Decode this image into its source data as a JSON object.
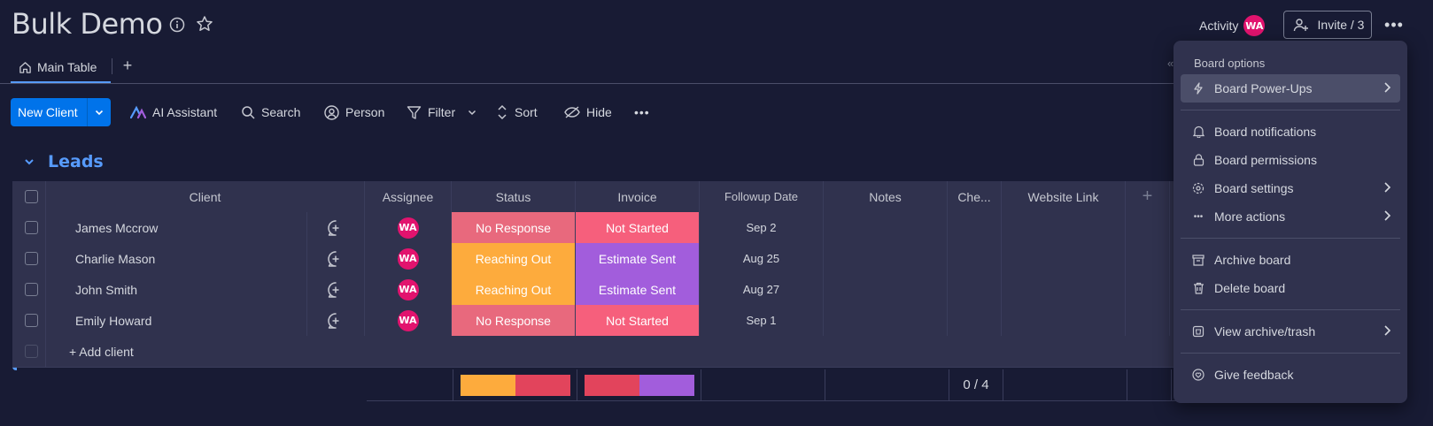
{
  "header": {
    "title": "Bulk Demo",
    "activity_label": "Activity",
    "user_initials": "WA",
    "invite_label": "Invite / 3"
  },
  "tabs": [
    {
      "label": "Main Table"
    }
  ],
  "toolbar": {
    "new_label": "New Client",
    "ai_label": "AI Assistant",
    "search_label": "Search",
    "person_label": "Person",
    "filter_label": "Filter",
    "sort_label": "Sort",
    "hide_label": "Hide"
  },
  "group": {
    "title": "Leads"
  },
  "table": {
    "columns": [
      "Client",
      "Assignee",
      "Status",
      "Invoice",
      "Followup Date",
      "Notes",
      "Che...",
      "Website Link"
    ],
    "rows": [
      {
        "client": "James Mccrow",
        "assignee": "WA",
        "status": "No Response",
        "invoice": "Not Started",
        "date": "Sep 2"
      },
      {
        "client": "Charlie Mason",
        "assignee": "WA",
        "status": "Reaching Out",
        "invoice": "Estimate Sent",
        "date": "Aug 25"
      },
      {
        "client": "John Smith",
        "assignee": "WA",
        "status": "Reaching Out",
        "invoice": "Estimate Sent",
        "date": "Aug 27"
      },
      {
        "client": "Emily Howard",
        "assignee": "WA",
        "status": "No Response",
        "invoice": "Not Started",
        "date": "Sep 1"
      }
    ],
    "add_label": "+ Add client",
    "check_summary": "0 / 4"
  },
  "colors": {
    "no_response": "#e8697d",
    "reaching_out": "#fdab3d",
    "not_started": "#f65f7c",
    "estimate_sent": "#a25ddc",
    "accent": "#579bfc"
  },
  "menu": {
    "heading": "Board options",
    "items": [
      {
        "label": "Board Power-Ups",
        "icon": "lightning-icon"
      },
      {
        "label": "Board notifications",
        "icon": "bell-icon"
      },
      {
        "label": "Board permissions",
        "icon": "lock-icon"
      },
      {
        "label": "Board settings",
        "icon": "gear-icon"
      },
      {
        "label": "More actions",
        "icon": "dots-icon"
      },
      {
        "label": "Archive board",
        "icon": "archive-icon"
      },
      {
        "label": "Delete board",
        "icon": "trash-icon"
      },
      {
        "label": "View archive/trash",
        "icon": "archive-view-icon"
      },
      {
        "label": "Give feedback",
        "icon": "feedback-icon"
      }
    ]
  }
}
